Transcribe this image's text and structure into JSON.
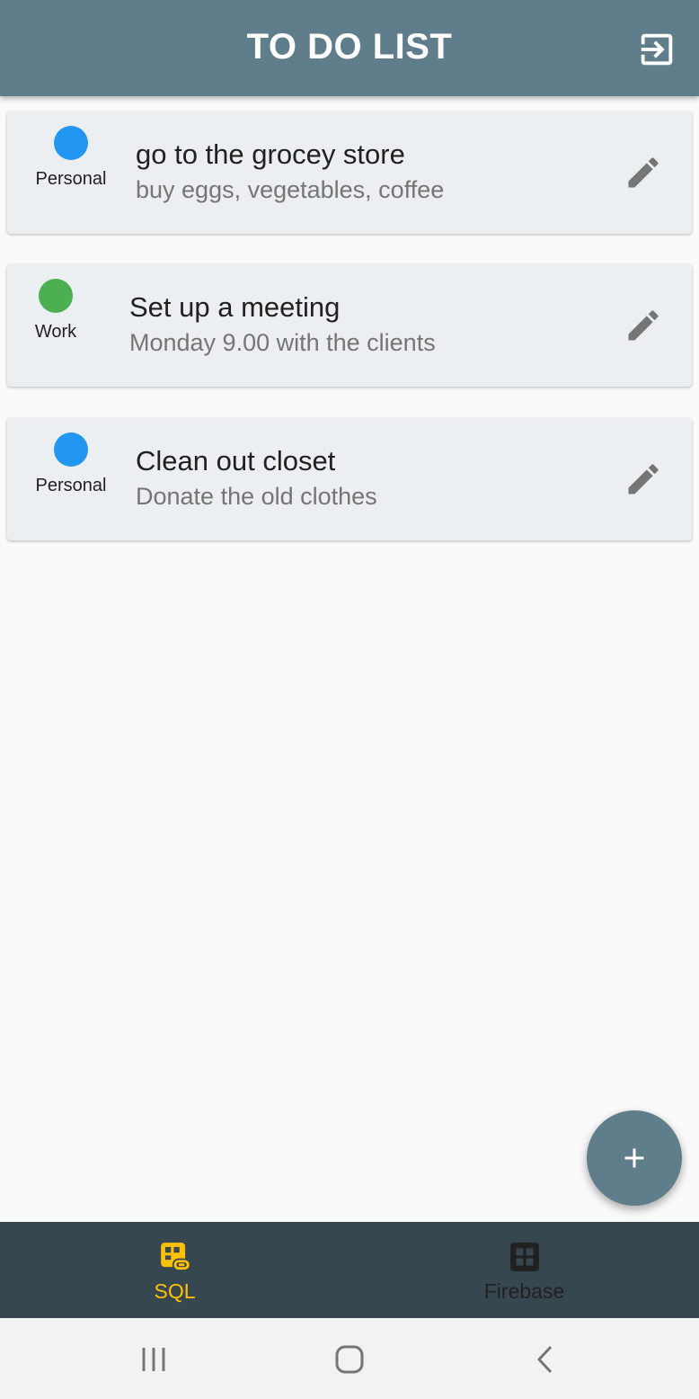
{
  "app_bar": {
    "title": "TO DO LIST",
    "action_icon": "logout-icon"
  },
  "tasks": [
    {
      "category": "Personal",
      "category_color": "#2196f3",
      "title": "go to the grocey store",
      "description": "buy eggs, vegetables, coffee",
      "action_icon": "edit-icon"
    },
    {
      "category": "Work",
      "category_color": "#4caf50",
      "title": "Set up a meeting",
      "description": "Monday 9.00 with the clients",
      "action_icon": "edit-icon"
    },
    {
      "category": "Personal",
      "category_color": "#2196f3",
      "title": "Clean out closet",
      "description": "Donate the old clothes",
      "action_icon": "edit-icon"
    }
  ],
  "fab": {
    "icon": "add-icon"
  },
  "bottom_nav": {
    "items": [
      {
        "label": "SQL",
        "icon": "sql-icon",
        "active": true
      },
      {
        "label": "Firebase",
        "icon": "firebase-icon",
        "active": false
      }
    ]
  },
  "system_nav": {
    "buttons": [
      "recent-apps-icon",
      "home-icon",
      "back-icon"
    ]
  },
  "colors": {
    "primary": "#607d8b",
    "bottom_nav_bg": "#37474f",
    "active_nav": "#ffc107",
    "inactive_nav": "#212121",
    "card_bg": "#eceff1",
    "background": "#fafafa",
    "personal": "#2196f3",
    "work": "#4caf50"
  }
}
